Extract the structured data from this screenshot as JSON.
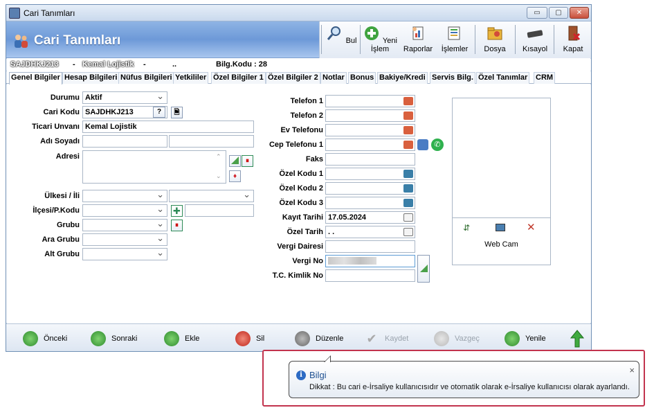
{
  "window": {
    "title": "Cari Tanımları"
  },
  "header": {
    "title": "Cari Tanımları"
  },
  "toolbar": {
    "bul": "Bul",
    "yeni_islem": "Yeni İşlem",
    "raporlar": "Raporlar",
    "islemler": "İşlemler",
    "dosya": "Dosya",
    "kisayol": "Kısayol",
    "kapat": "Kapat"
  },
  "infobar": {
    "code": "SAJDHKJ213",
    "sep1": "-",
    "name": "Kemal Lojistik",
    "sep2": "-",
    "dots": "..",
    "bilg_kodu": "Bilg.Kodu : 28"
  },
  "tabs": [
    "Genel Bilgiler",
    "Hesap Bilgileri",
    "Nüfus Bilgileri",
    "Yetkililer",
    "Özel Bilgiler 1",
    "Özel Bilgiler 2",
    "Notlar",
    "Bonus",
    "Bakiye/Kredi",
    "Servis Bilg.",
    "Özel Tanımlar",
    "CRM"
  ],
  "form_left": {
    "durumu_label": "Durumu",
    "durumu_value": "Aktif",
    "cari_kodu_label": "Cari Kodu",
    "cari_kodu_value": "SAJDHKJ213",
    "cari_kodu_help": "?",
    "ticari_unvani_label": "Ticari Unvanı",
    "ticari_unvani_value": "Kemal Lojistik",
    "adi_soyadi_label": "Adı Soyadı",
    "adresi_label": "Adresi",
    "ulkesi_label": "Ülkesi / İli",
    "ilcesi_label": "İlçesi/P.Kodu",
    "grubu_label": "Grubu",
    "ara_grubu_label": "Ara Grubu",
    "alt_grubu_label": "Alt Grubu"
  },
  "form_right": {
    "telefon1_label": "Telefon 1",
    "telefon2_label": "Telefon 2",
    "ev_telefonu_label": "Ev Telefonu",
    "cep_telefonu_label": "Cep Telefonu 1",
    "faks_label": "Faks",
    "ozel_kodu1_label": "Özel Kodu 1",
    "ozel_kodu2_label": "Özel Kodu 2",
    "ozel_kodu3_label": "Özel Kodu 3",
    "kayit_tarihi_label": "Kayıt Tarihi",
    "kayit_tarihi_value": "17.05.2024",
    "ozel_tarih_label": "Özel Tarih",
    "ozel_tarih_value": ". .",
    "vergi_dairesi_label": "Vergi Dairesi",
    "vergi_no_label": "Vergi No",
    "tc_kimlik_label": "T.C. Kimlik No"
  },
  "photo": {
    "webcam_label": "Web Cam"
  },
  "bottombar": {
    "onceki": "Önceki",
    "sonraki": "Sonraki",
    "ekle": "Ekle",
    "sil": "Sil",
    "duzenle": "Düzenle",
    "kaydet": "Kaydet",
    "vazgec": "Vazgeç",
    "yenile": "Yenile"
  },
  "notice": {
    "title": "Bilgi",
    "message": "Dikkat : Bu cari e-İrsaliye kullanıcısıdır ve otomatik olarak e-İrsaliye kullanıcısı olarak ayarlandı.",
    "close": "×"
  },
  "colors": {
    "accent_header": "#6d99d8",
    "notice_border": "#c2334d",
    "notice_title": "#1d4f91"
  }
}
